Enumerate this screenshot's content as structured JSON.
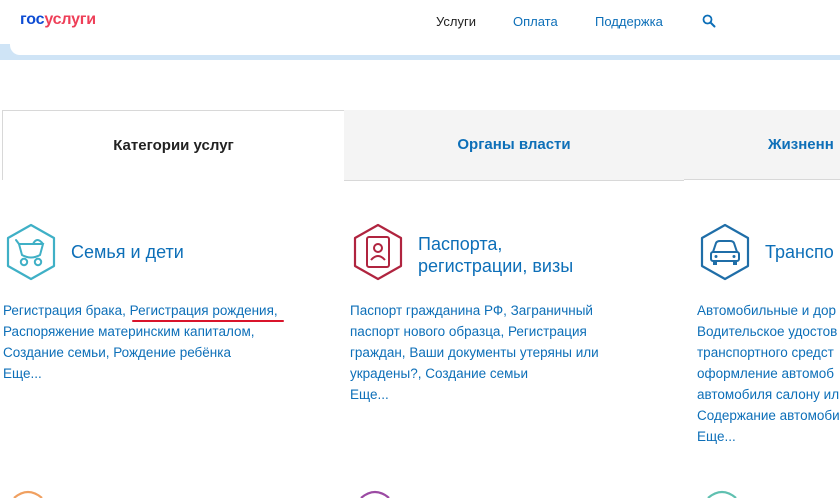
{
  "header": {
    "logo_part1": "гос",
    "logo_part2": "услуги",
    "nav": [
      {
        "label": "Услуги"
      },
      {
        "label": "Оплата"
      },
      {
        "label": "Поддержка"
      }
    ]
  },
  "tabs": [
    {
      "label": "Категории услуг"
    },
    {
      "label": "Органы власти"
    },
    {
      "label": "Жизненн"
    }
  ],
  "categories": [
    {
      "title_line1": "Семья и дети",
      "title_line2": "",
      "links": [
        "Регистрация брака",
        ", ",
        "Регистрация рождения",
        ",",
        "Распоряжение материнским капиталом,",
        "Создание семьи, Рождение ребёнка"
      ],
      "more": "Еще...",
      "icon": "baby-carriage-icon",
      "color": "#3fb0c6"
    },
    {
      "title_line1": "Паспорта,",
      "title_line2": "регистрации, визы",
      "links": [
        "Паспорт гражданина РФ, Заграничный",
        "паспорт нового образца, Регистрация",
        "граждан, Ваши документы утеряны или",
        "украдены?, Создание семьи"
      ],
      "more": "Еще...",
      "icon": "passport-icon",
      "color": "#b0243f"
    },
    {
      "title_line1": "Транспо",
      "title_line2": "",
      "links": [
        "Автомобильные и дор",
        "Водительское удостов",
        "транспортного средст",
        "оформление автомоб",
        "автомобиля салону ил",
        "Содержание автомоби"
      ],
      "more": "Еще...",
      "icon": "car-icon",
      "color": "#1f6ea8"
    }
  ],
  "colors": {
    "accent": "#0d6fb8",
    "brand_red": "#ee3f58",
    "underline": "#d9142b"
  }
}
